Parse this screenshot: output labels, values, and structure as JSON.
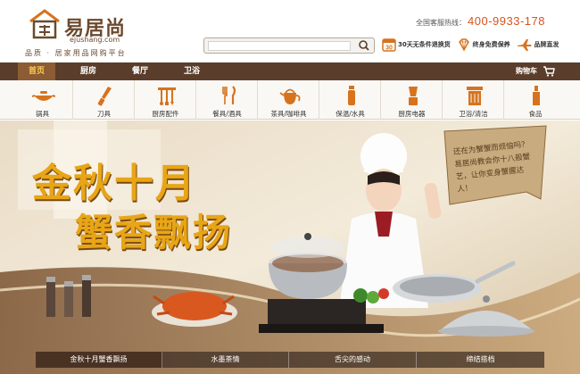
{
  "brand": {
    "name": "易居尚",
    "domain": "ejushang.com",
    "slogan": "品质 · 居家用品网购平台",
    "color": "#6b4a2e"
  },
  "search": {
    "placeholder": "",
    "icon": "search-icon"
  },
  "hotline": {
    "label": "全国客服热线：",
    "number": "400-9933-178",
    "color": "#d7541d"
  },
  "promises": [
    {
      "icon": "calendar-30-icon",
      "label": "30天无条件退换货"
    },
    {
      "icon": "diamond-icon",
      "label": "终身免费保养"
    },
    {
      "icon": "airplane-icon",
      "label": "品牌直发"
    }
  ],
  "nav": {
    "items": [
      {
        "label": "首页",
        "active": true
      },
      {
        "label": "厨房"
      },
      {
        "label": "餐厅"
      },
      {
        "label": "卫浴"
      }
    ],
    "cart_label": "购物车",
    "bg_color": "#5a3d2a",
    "active_color": "#ffcc55"
  },
  "categories": [
    {
      "label": "锅具",
      "icon": "wok-icon"
    },
    {
      "label": "刀具",
      "icon": "knife-icon"
    },
    {
      "label": "厨房配件",
      "icon": "utensil-rack-icon"
    },
    {
      "label": "餐具/酒具",
      "icon": "cutlery-icon"
    },
    {
      "label": "茶具/咖啡具",
      "icon": "teapot-icon"
    },
    {
      "label": "保温/水具",
      "icon": "thermos-icon"
    },
    {
      "label": "厨房电器",
      "icon": "blender-icon"
    },
    {
      "label": "卫浴/清洁",
      "icon": "bath-icon"
    },
    {
      "label": "食品",
      "icon": "bottle-icon"
    }
  ],
  "banner": {
    "headline_1": "金秋十月",
    "headline_2": "蟹香飘扬",
    "note": "还在为蟹蟹而烦恼吗？易居尚教会你十八般蟹艺，让你变身蟹握达人！",
    "headline_color": "#e8a516"
  },
  "banner_tabs": [
    {
      "label": "金秋十月蟹香飘扬",
      "active": true
    },
    {
      "label": "水墨茶情"
    },
    {
      "label": "舌尖的感动"
    },
    {
      "label": "缔结搭档"
    }
  ]
}
